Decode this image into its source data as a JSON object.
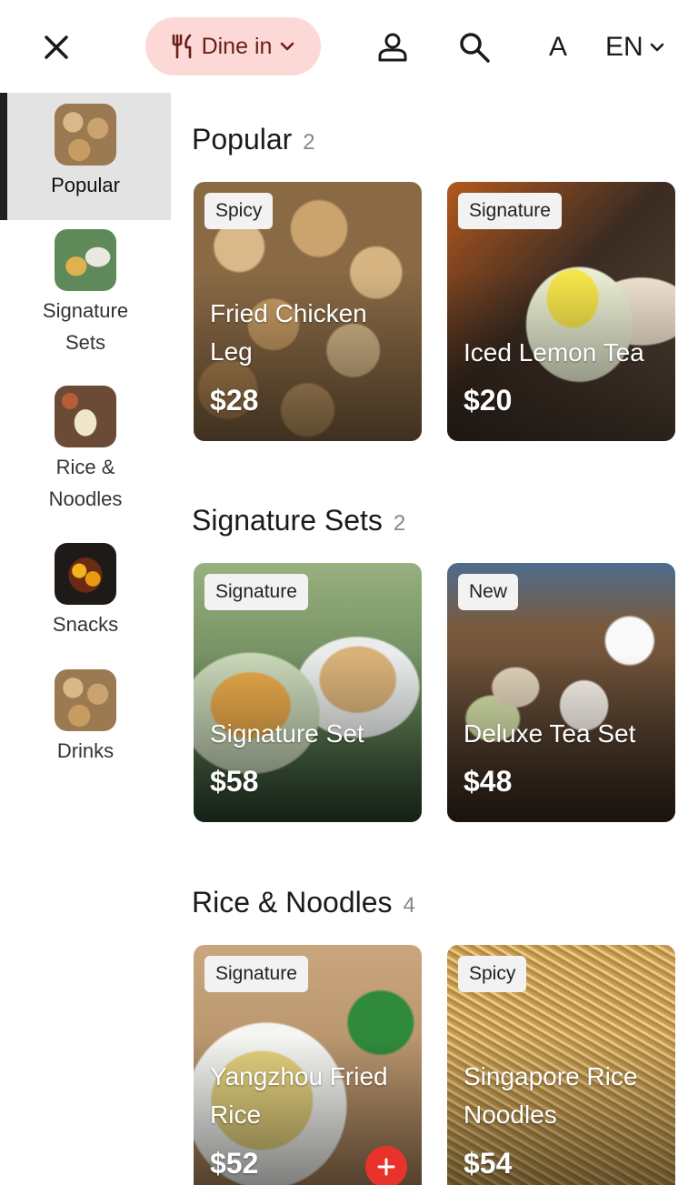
{
  "header": {
    "close_icon": "close-icon",
    "dine_mode": "Dine in",
    "dine_icon": "fork-knife-icon",
    "account_icon": "person-icon",
    "search_icon": "search-icon",
    "font_size_label": "A",
    "language": "EN"
  },
  "sidebar": {
    "items": [
      {
        "label": "Popular",
        "active": true
      },
      {
        "label": "Signature Sets",
        "active": false
      },
      {
        "label": "Rice & Noodles",
        "active": false
      },
      {
        "label": "Snacks",
        "active": false
      },
      {
        "label": "Drinks",
        "active": false
      }
    ]
  },
  "sections": [
    {
      "title": "Popular",
      "count": "2",
      "items": [
        {
          "badge": "Spicy",
          "name": "Fried Chicken Leg",
          "price": "$28"
        },
        {
          "badge": "Signature",
          "name": "Iced Lemon Tea",
          "price": "$20"
        }
      ]
    },
    {
      "title": "Signature Sets",
      "count": "2",
      "items": [
        {
          "badge": "Signature",
          "name": "Signature Set",
          "price": "$58"
        },
        {
          "badge": "New",
          "name": "Deluxe Tea Set",
          "price": "$48"
        }
      ]
    },
    {
      "title": "Rice & Noodles",
      "count": "4",
      "items": [
        {
          "badge": "Signature",
          "name": "Yangzhou Fried Rice",
          "price": "$52"
        },
        {
          "badge": "Spicy",
          "name": "Singapore Rice Noodles",
          "price": "$54"
        }
      ]
    }
  ],
  "colors": {
    "dine_pill_bg": "#fcd9d6",
    "dine_pill_text": "#6a1e16",
    "add_button": "#e8332c",
    "active_category_bg": "#e3e3e3"
  }
}
